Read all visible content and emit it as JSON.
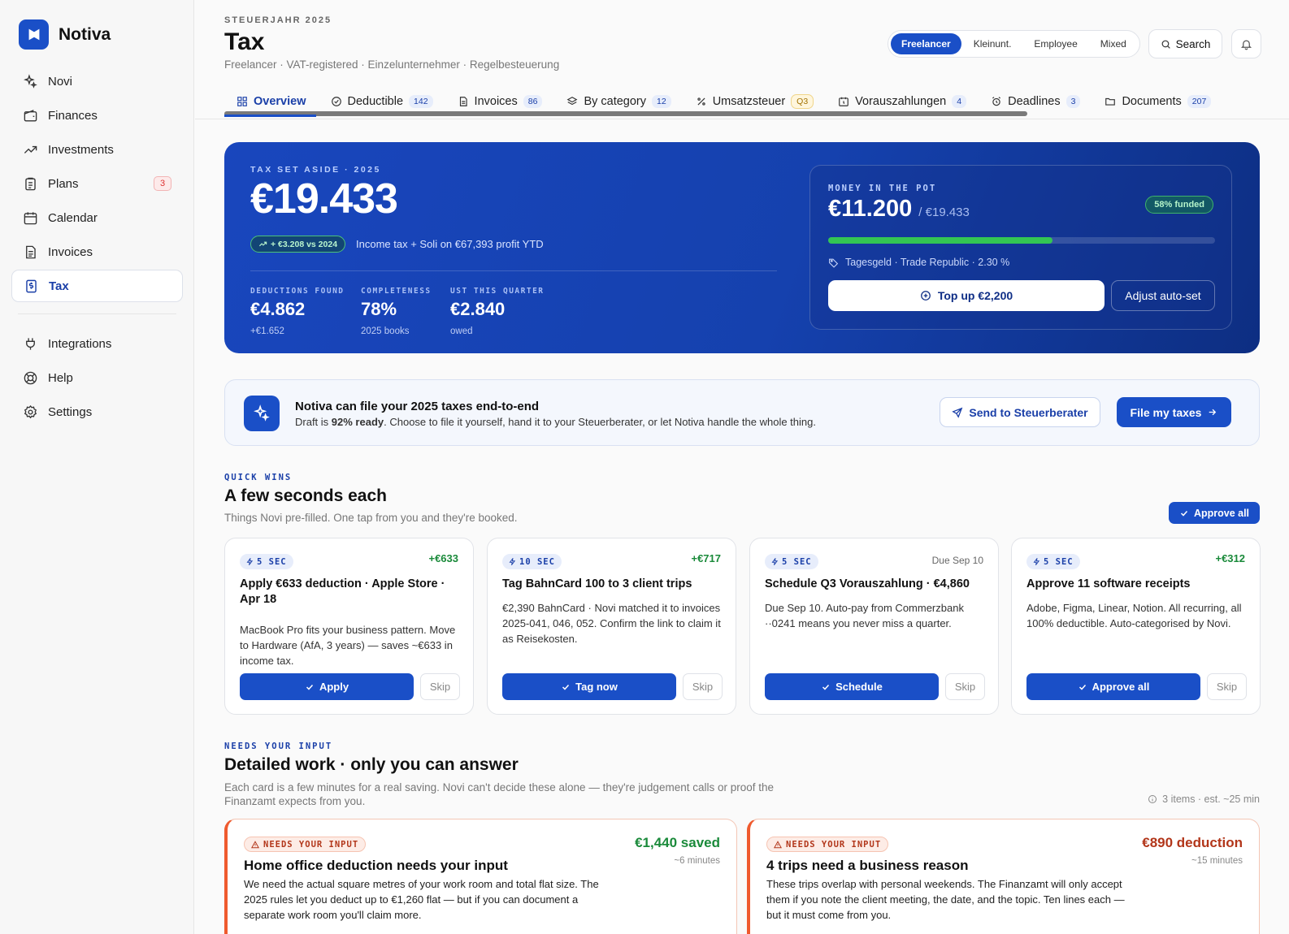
{
  "app": {
    "name": "Notiva"
  },
  "sidebar": {
    "items": [
      {
        "label": "Novi"
      },
      {
        "label": "Finances"
      },
      {
        "label": "Investments"
      },
      {
        "label": "Plans",
        "badge": "3"
      },
      {
        "label": "Calendar"
      },
      {
        "label": "Invoices"
      },
      {
        "label": "Tax",
        "active": true
      }
    ],
    "secondary": [
      {
        "label": "Integrations"
      },
      {
        "label": "Help"
      },
      {
        "label": "Settings"
      }
    ]
  },
  "header": {
    "eyebrow": "STEUERJAHR 2025",
    "title": "Tax",
    "subtitle": "Freelancer · VAT-registered · Einzelunternehmer · Regelbesteuerung",
    "segments": [
      "Freelancer",
      "Kleinunt.",
      "Employee",
      "Mixed"
    ],
    "active_segment": "Freelancer",
    "search_label": "Search"
  },
  "tabs": [
    {
      "label": "Overview",
      "icon": "grid-icon"
    },
    {
      "label": "Deductible",
      "count": "142",
      "icon": "check-circle-icon"
    },
    {
      "label": "Invoices",
      "count": "86",
      "icon": "document-icon"
    },
    {
      "label": "By category",
      "count": "12",
      "icon": "layers-icon"
    },
    {
      "label": "Umsatzsteuer",
      "count": "Q3",
      "icon": "percent-icon"
    },
    {
      "label": "Vorauszahlungen",
      "count": "4",
      "icon": "calendar-clock-icon"
    },
    {
      "label": "Deadlines",
      "count": "3",
      "icon": "alarm-icon"
    },
    {
      "label": "Documents",
      "count": "207",
      "icon": "folder-icon"
    }
  ],
  "hero": {
    "eyebrow": "TAX SET ASIDE · 2025",
    "amount": "€19.433",
    "delta": "+ €3.208 vs 2024",
    "note": "Income tax + Soli on €67,393 profit YTD",
    "stats": [
      {
        "label": "DEDUCTIONS FOUND",
        "value": "€4.862",
        "sub": "+€1.652"
      },
      {
        "label": "COMPLETENESS",
        "value": "78%",
        "sub": "2025 books"
      },
      {
        "label": "UST THIS QUARTER",
        "value": "€2.840",
        "sub": "owed"
      }
    ],
    "pot": {
      "eyebrow": "MONEY IN THE POT",
      "amount": "€11.200",
      "of": "/ €19.433",
      "funded": "58% funded",
      "funded_fraction": 0.58,
      "meta": "Tagesgeld · Trade Republic · 2.30 %",
      "topup_label": "Top up €2,200",
      "adjust_label": "Adjust auto-set"
    }
  },
  "file_banner": {
    "title": "Notiva can file your 2025 taxes end-to-end",
    "desc_pre": "Draft is ",
    "desc_bold": "92% ready",
    "desc_post": ". Choose to file it yourself, hand it to your Steuerberater, or let Notiva handle the whole thing.",
    "send_label": "Send to Steuerberater",
    "file_label": "File my taxes"
  },
  "quick_wins": {
    "eyebrow": "QUICK WINS",
    "title": "A few seconds each",
    "subtitle": "Things Novi pre-filled. One tap from you and they're booked.",
    "approve_all": "Approve all",
    "cards": [
      {
        "chip": "5 SEC",
        "value": "+€633",
        "title": "Apply €633 deduction · Apple Store · Apr 18",
        "desc": "MacBook Pro fits your business pattern. Move to Hardware (AfA, 3 years) — saves ~€633 in income tax.",
        "action": "Apply",
        "skip": "Skip"
      },
      {
        "chip": "10 SEC",
        "value": "+€717",
        "title": "Tag BahnCard 100 to 3 client trips",
        "desc": "€2,390 BahnCard · Novi matched it to invoices 2025-041, 046, 052. Confirm the link to claim it as Reisekosten.",
        "action": "Tag now",
        "skip": "Skip"
      },
      {
        "chip": "5 SEC",
        "value": "Due Sep 10",
        "title": "Schedule Q3 Vorauszahlung · €4,860",
        "desc": "Due Sep 10. Auto-pay from Commerzbank ··0241 means you never miss a quarter.",
        "action": "Schedule",
        "skip": "Skip"
      },
      {
        "chip": "5 SEC",
        "value": "+€312",
        "title": "Approve 11 software receipts",
        "desc": "Adobe, Figma, Linear, Notion. All recurring, all 100% deductible. Auto-categorised by Novi.",
        "action": "Approve all",
        "skip": "Skip"
      }
    ]
  },
  "needs_input": {
    "eyebrow": "NEEDS YOUR INPUT",
    "title": "Detailed work · only you can answer",
    "subtitle": "Each card is a few minutes for a real saving. Novi can't decide these alone — they're judgement calls or proof the Finanzamt expects from you.",
    "meta": "3 items · est. ~25 min",
    "cards": [
      {
        "chip": "NEEDS YOUR INPUT",
        "value": "€1,440 saved",
        "value_color": "#1a8a3a",
        "time": "~6 minutes",
        "title": "Home office deduction needs your input",
        "desc": "We need the actual square metres of your work room and total flat size. The 2025 rules let you deduct up to €1,260 flat — but if you can document a separate work room you'll claim more."
      },
      {
        "chip": "NEEDS YOUR INPUT",
        "value": "€890 deduction",
        "value_color": "#b2361a",
        "time": "~15 minutes",
        "title": "4 trips need a business reason",
        "desc": "These trips overlap with personal weekends. The Finanzamt will only accept them if you note the client meeting, the date, and the topic. Ten lines each — but it must come from you."
      }
    ]
  }
}
